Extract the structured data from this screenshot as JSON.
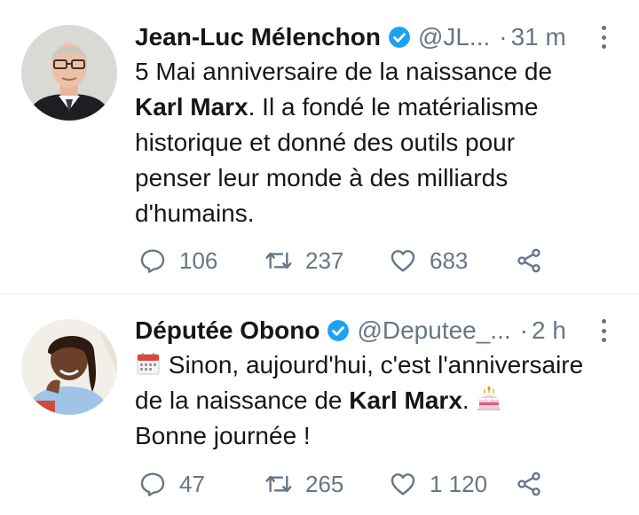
{
  "tweets": [
    {
      "author_name": "Jean-Luc Mélenchon",
      "handle": "@JL...",
      "separator": "·",
      "time": "31 m",
      "text_parts": {
        "line1": "5 Mai anniversaire de la naissance de",
        "bold": "Karl Marx",
        "after_bold": ". Il a fondé le matérialisme",
        "line3": "historique et donné des outils pour",
        "line4": "penser leur monde à des milliards",
        "line5": "d'humains."
      },
      "replies": "106",
      "retweets": "237",
      "likes": "683"
    },
    {
      "author_name": "Députée Obono",
      "handle": "@Deputee_...",
      "separator": "·",
      "time": "2 h",
      "text_parts": {
        "line1": " Sinon, aujourd'hui, c'est l'anniversaire",
        "line2_before": "de la naissance de ",
        "bold": "Karl Marx",
        "line2_after": ". ",
        "line3": "Bonne journée !"
      },
      "replies": "47",
      "retweets": "265",
      "likes": "1 120"
    }
  ],
  "colors": {
    "verified_blue": "#1da1f2",
    "secondary_text": "#657786",
    "divider": "#e1e8ed"
  },
  "icons": {
    "reply": "reply-icon",
    "retweet": "retweet-icon",
    "like": "like-icon",
    "share": "share-icon",
    "verified": "verified-badge-icon",
    "more": "more-options-icon",
    "calendar": "calendar-emoji",
    "cake": "birthday-cake-emoji"
  }
}
